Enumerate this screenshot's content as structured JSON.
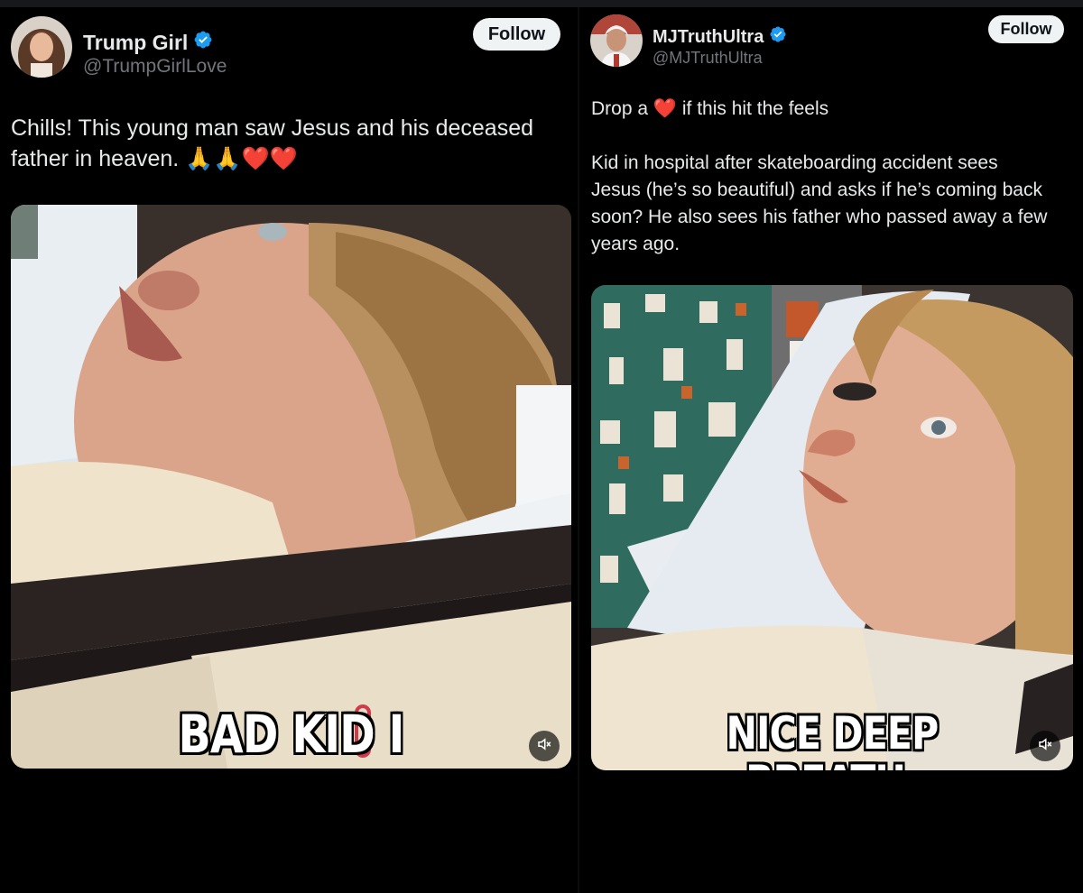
{
  "posts": [
    {
      "display_name": "Trump Girl",
      "handle": "@TrumpGirlLove",
      "follow_label": "Follow",
      "text_line1": "Chills! This young man saw Jesus and his deceased",
      "text_line2": "father in heaven.",
      "emoji": "🙏🙏❤️❤️",
      "video_caption": "BAD KID I",
      "icons": {
        "verified": "verified-badge",
        "mute": "speaker-muted"
      }
    },
    {
      "display_name": "MJTruthUltra",
      "handle": "@MJTruthUltra",
      "follow_label": "Follow",
      "text_drop_a": "Drop a",
      "text_heart": "❤️",
      "text_hit": "if this hit the feels",
      "text_body_lines": [
        "Kid in hospital after skateboarding accident sees",
        "Jesus (he’s so beautiful) and asks if he’s coming back",
        "soon? He also sees his father who passed away a few",
        "years ago."
      ],
      "video_caption": "NICE DEEP BREATH.",
      "icons": {
        "verified": "verified-badge",
        "mute": "speaker-muted"
      }
    }
  ],
  "colors": {
    "background": "#000000",
    "text": "#e7e9ea",
    "muted": "#71767b",
    "verified": "#1d9bf0",
    "follow_bg": "#eff3f4"
  }
}
